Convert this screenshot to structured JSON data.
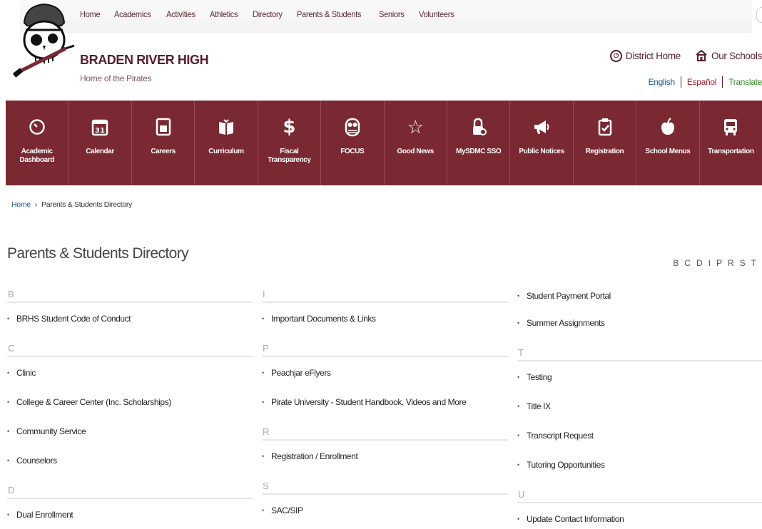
{
  "topnav": {
    "items": [
      "Home",
      "Academics",
      "Activities",
      "Athletics",
      "Directory",
      "Parents & Students",
      "Seniors",
      "Volunteers"
    ]
  },
  "header": {
    "school_name": "BRADEN RIVER HIGH",
    "tagline": "Home of the Pirates",
    "district_home": "District Home",
    "our_schools": "Our Schools",
    "languages": [
      "English",
      "Español",
      "Translate"
    ]
  },
  "quicklinks": [
    {
      "label": "Academic Dashboard",
      "icon": "dashboard-icon"
    },
    {
      "label": "Calendar",
      "icon": "calendar-icon"
    },
    {
      "label": "Careers",
      "icon": "jobs-icon"
    },
    {
      "label": "Curriculum",
      "icon": "book-icon"
    },
    {
      "label": "Fiscal Transparency",
      "icon": "dollar-icon"
    },
    {
      "label": "FOCUS",
      "icon": "owl-icon"
    },
    {
      "label": "Good News",
      "icon": "star-icon"
    },
    {
      "label": "MySDMC SSO",
      "icon": "lock-icon"
    },
    {
      "label": "Public Notices",
      "icon": "megaphone-icon"
    },
    {
      "label": "Registration",
      "icon": "clipboard-icon"
    },
    {
      "label": "School Menus",
      "icon": "apple-icon"
    },
    {
      "label": "Transportation",
      "icon": "bus-icon"
    }
  ],
  "breadcrumb": {
    "home": "Home",
    "separator": "›",
    "current": "Parents & Students Directory"
  },
  "page_title": "Parents & Students Directory",
  "alphabet": [
    "B",
    "C",
    "D",
    "I",
    "P",
    "R",
    "S",
    "T"
  ],
  "colors": {
    "maroon": "#7a2831",
    "accent": "#581e2a",
    "link_blue": "#1a5aa0"
  },
  "directory": {
    "col1": [
      {
        "letter": "B",
        "items": [
          "BRHS Student Code of Conduct"
        ]
      },
      {
        "letter": "C",
        "items": [
          "Clinic",
          "College & Career Center (Inc. Scholarships)",
          "Community Service",
          "Counselors"
        ]
      },
      {
        "letter": "D",
        "items": [
          "Dual Enrollment"
        ]
      }
    ],
    "col2": [
      {
        "letter": "I",
        "items": [
          "Important Documents & Links"
        ]
      },
      {
        "letter": "P",
        "items": [
          "Peachjar eFlyers",
          "Pirate University - Student Handbook, Videos and More"
        ]
      },
      {
        "letter": "R",
        "items": [
          "Registration / Enrollment"
        ]
      },
      {
        "letter": "S",
        "items": [
          "SAC/SIP"
        ]
      }
    ],
    "col3_top": [
      "Student Payment Portal",
      "Summer Assignments"
    ],
    "col3": [
      {
        "letter": "T",
        "items": [
          "Testing",
          "Title IX",
          "Transcript Request",
          "Tutoring Opportunities"
        ]
      },
      {
        "letter": "U",
        "items": [
          "Update Contact Information"
        ]
      }
    ]
  }
}
